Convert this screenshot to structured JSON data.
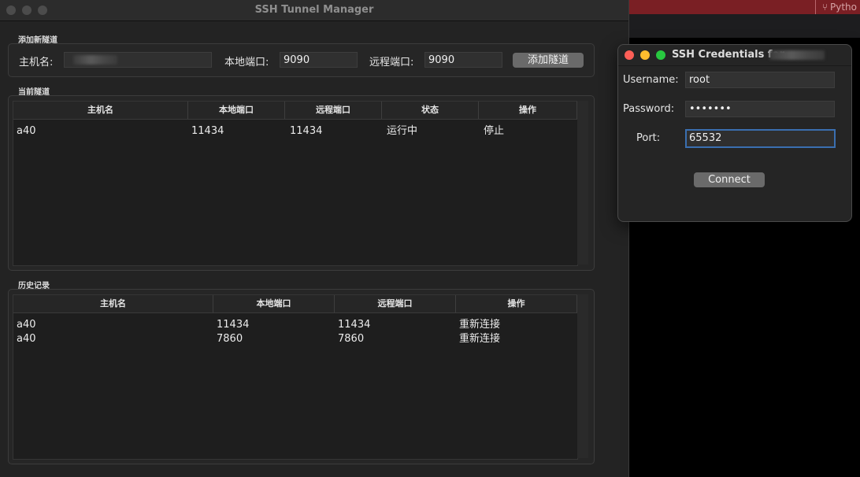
{
  "background": {
    "python_label": "Pytho",
    "branch_icon": "branch-icon"
  },
  "main_window": {
    "title": "SSH Tunnel Manager",
    "add_section": {
      "label": "添加新隧道",
      "host_label": "主机名:",
      "host_value": "",
      "local_port_label": "本地端口:",
      "local_port_value": "9090",
      "remote_port_label": "远程端口:",
      "remote_port_value": "9090",
      "add_button": "添加隧道"
    },
    "current_section": {
      "label": "当前隧道",
      "columns": [
        "主机名",
        "本地端口",
        "远程端口",
        "状态",
        "操作"
      ],
      "rows": [
        [
          "a40",
          "11434",
          "11434",
          "运行中",
          "停止"
        ]
      ]
    },
    "history_section": {
      "label": "历史记录",
      "columns": [
        "主机名",
        "本地端口",
        "远程端口",
        "操作"
      ],
      "rows": [
        [
          "a40",
          "11434",
          "11434",
          "重新连接"
        ],
        [
          "a40",
          "7860",
          "7860",
          "重新连接"
        ]
      ]
    }
  },
  "credentials_dialog": {
    "title": "SSH Credentials for",
    "username_label": "Username:",
    "username_value": "root",
    "password_label": "Password:",
    "password_value": "•••••••",
    "port_label": "Port:",
    "port_value": "65532",
    "connect_button": "Connect"
  },
  "colors": {
    "traffic_red": "#fe5f57",
    "traffic_yellow": "#febc2e",
    "traffic_green": "#28c840",
    "focus_ring": "#3a6fb0"
  }
}
